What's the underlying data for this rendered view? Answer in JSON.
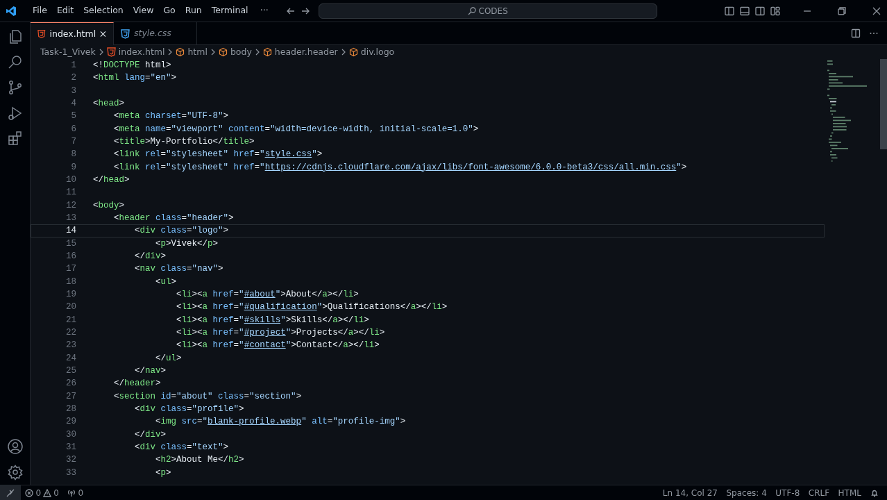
{
  "title_bar": {
    "menus": [
      "File",
      "Edit",
      "Selection",
      "View",
      "Go",
      "Run",
      "Terminal"
    ],
    "more": "···",
    "search": "CODES"
  },
  "tabs": [
    {
      "label": "index.html",
      "kind": "html",
      "selected": true,
      "preview": false
    },
    {
      "label": "style.css",
      "kind": "css",
      "selected": false,
      "preview": true
    }
  ],
  "breadcrumbs": [
    {
      "label": "Task-1_Vivek",
      "kind": "folder"
    },
    {
      "label": "index.html",
      "kind": "html"
    },
    {
      "label": "html",
      "kind": "element"
    },
    {
      "label": "body",
      "kind": "element"
    },
    {
      "label": "header.header",
      "kind": "element"
    },
    {
      "label": "div.logo",
      "kind": "element"
    }
  ],
  "editor": {
    "lines": [
      {
        "number": "1",
        "selected": false,
        "tokens": [
          {
            "kind": "punct",
            "text": "<!"
          },
          {
            "kind": "tag",
            "text": "DOCTYPE"
          },
          {
            "kind": "text",
            "text": " html"
          },
          {
            "kind": "punct",
            "text": ">"
          }
        ]
      },
      {
        "number": "2",
        "selected": false,
        "tokens": [
          {
            "kind": "punct",
            "text": "<"
          },
          {
            "kind": "tag",
            "text": "html"
          },
          {
            "kind": "attr",
            "text": " lang"
          },
          {
            "kind": "punct",
            "text": "="
          },
          {
            "kind": "string",
            "text": "\"en\""
          },
          {
            "kind": "punct",
            "text": ">"
          }
        ]
      },
      {
        "number": "3",
        "selected": false
      },
      {
        "number": "4",
        "selected": false,
        "tokens": [
          {
            "kind": "punct",
            "text": "<"
          },
          {
            "kind": "tag",
            "text": "head"
          },
          {
            "kind": "punct",
            "text": ">"
          }
        ]
      },
      {
        "number": "5",
        "selected": false,
        "tokens": [
          {
            "kind": "punct",
            "text": "    <"
          },
          {
            "kind": "tag",
            "text": "meta"
          },
          {
            "kind": "attr",
            "text": " charset"
          },
          {
            "kind": "punct",
            "text": "="
          },
          {
            "kind": "string",
            "text": "\"UTF-8\""
          },
          {
            "kind": "punct",
            "text": ">"
          }
        ]
      },
      {
        "number": "6",
        "selected": false,
        "tokens": [
          {
            "kind": "punct",
            "text": "    <"
          },
          {
            "kind": "tag",
            "text": "meta"
          },
          {
            "kind": "attr",
            "text": " name"
          },
          {
            "kind": "punct",
            "text": "="
          },
          {
            "kind": "string",
            "text": "\"viewport\""
          },
          {
            "kind": "attr",
            "text": " content"
          },
          {
            "kind": "punct",
            "text": "="
          },
          {
            "kind": "string",
            "text": "\"width=device-width, initial-scale=1.0\""
          },
          {
            "kind": "punct",
            "text": ">"
          }
        ]
      },
      {
        "number": "7",
        "selected": false,
        "tokens": [
          {
            "kind": "punct",
            "text": "    <"
          },
          {
            "kind": "tag",
            "text": "title"
          },
          {
            "kind": "punct",
            "text": ">"
          },
          {
            "kind": "text",
            "text": "My-Portfolio"
          },
          {
            "kind": "punct",
            "text": "</"
          },
          {
            "kind": "tag",
            "text": "title"
          },
          {
            "kind": "punct",
            "text": ">"
          }
        ]
      },
      {
        "number": "8",
        "selected": false,
        "tokens": [
          {
            "kind": "punct",
            "text": "    <"
          },
          {
            "kind": "tag",
            "text": "link"
          },
          {
            "kind": "attr",
            "text": " rel"
          },
          {
            "kind": "punct",
            "text": "="
          },
          {
            "kind": "string",
            "text": "\"stylesheet\""
          },
          {
            "kind": "attr",
            "text": " href"
          },
          {
            "kind": "punct",
            "text": "="
          },
          {
            "kind": "string",
            "text": "\""
          },
          {
            "kind": "link",
            "text": "style.css"
          },
          {
            "kind": "string",
            "text": "\""
          },
          {
            "kind": "punct",
            "text": ">"
          }
        ]
      },
      {
        "number": "9",
        "selected": false,
        "tokens": [
          {
            "kind": "punct",
            "text": "    <"
          },
          {
            "kind": "tag",
            "text": "link"
          },
          {
            "kind": "attr",
            "text": " rel"
          },
          {
            "kind": "punct",
            "text": "="
          },
          {
            "kind": "string",
            "text": "\"stylesheet\""
          },
          {
            "kind": "attr",
            "text": " href"
          },
          {
            "kind": "punct",
            "text": "="
          },
          {
            "kind": "string",
            "text": "\""
          },
          {
            "kind": "link",
            "text": "https://cdnjs.cloudflare.com/ajax/libs/font-awesome/6.0.0-beta3/css/all.min.css"
          },
          {
            "kind": "string",
            "text": "\""
          },
          {
            "kind": "punct",
            "text": ">"
          }
        ]
      },
      {
        "number": "10",
        "selected": false,
        "tokens": [
          {
            "kind": "punct",
            "text": "</"
          },
          {
            "kind": "tag",
            "text": "head"
          },
          {
            "kind": "punct",
            "text": ">"
          }
        ]
      },
      {
        "number": "11",
        "selected": false
      },
      {
        "number": "12",
        "selected": false,
        "tokens": [
          {
            "kind": "punct",
            "text": "<"
          },
          {
            "kind": "tag",
            "text": "body"
          },
          {
            "kind": "punct",
            "text": ">"
          }
        ]
      },
      {
        "number": "13",
        "selected": false,
        "tokens": [
          {
            "kind": "punct",
            "text": "    <"
          },
          {
            "kind": "tag",
            "text": "header"
          },
          {
            "kind": "attr",
            "text": " class"
          },
          {
            "kind": "punct",
            "text": "="
          },
          {
            "kind": "string",
            "text": "\"header\""
          },
          {
            "kind": "punct",
            "text": ">"
          }
        ]
      },
      {
        "number": "14",
        "selected": true,
        "tokens": [
          {
            "kind": "punct",
            "text": "        <"
          },
          {
            "kind": "tag",
            "text": "div"
          },
          {
            "kind": "attr",
            "text": " class"
          },
          {
            "kind": "punct",
            "text": "="
          },
          {
            "kind": "string",
            "text": "\"logo\""
          },
          {
            "kind": "punct",
            "text": ">"
          }
        ]
      },
      {
        "number": "15",
        "selected": false,
        "tokens": [
          {
            "kind": "punct",
            "text": "            <"
          },
          {
            "kind": "tag",
            "text": "p"
          },
          {
            "kind": "punct",
            "text": ">"
          },
          {
            "kind": "text",
            "text": "Vivek"
          },
          {
            "kind": "punct",
            "text": "</"
          },
          {
            "kind": "tag",
            "text": "p"
          },
          {
            "kind": "punct",
            "text": ">"
          }
        ]
      },
      {
        "number": "16",
        "selected": false,
        "tokens": [
          {
            "kind": "punct",
            "text": "        </"
          },
          {
            "kind": "tag",
            "text": "div"
          },
          {
            "kind": "punct",
            "text": ">"
          }
        ]
      },
      {
        "number": "17",
        "selected": false,
        "tokens": [
          {
            "kind": "punct",
            "text": "        <"
          },
          {
            "kind": "tag",
            "text": "nav"
          },
          {
            "kind": "attr",
            "text": " class"
          },
          {
            "kind": "punct",
            "text": "="
          },
          {
            "kind": "string",
            "text": "\"nav\""
          },
          {
            "kind": "punct",
            "text": ">"
          }
        ]
      },
      {
        "number": "18",
        "selected": false,
        "tokens": [
          {
            "kind": "punct",
            "text": "            <"
          },
          {
            "kind": "tag",
            "text": "ul"
          },
          {
            "kind": "punct",
            "text": ">"
          }
        ]
      },
      {
        "number": "19",
        "selected": false,
        "tokens": [
          {
            "kind": "punct",
            "text": "                <"
          },
          {
            "kind": "tag",
            "text": "li"
          },
          {
            "kind": "punct",
            "text": "><"
          },
          {
            "kind": "tag",
            "text": "a"
          },
          {
            "kind": "attr",
            "text": " href"
          },
          {
            "kind": "punct",
            "text": "="
          },
          {
            "kind": "string",
            "text": "\""
          },
          {
            "kind": "link",
            "text": "#about"
          },
          {
            "kind": "string",
            "text": "\""
          },
          {
            "kind": "punct",
            "text": ">"
          },
          {
            "kind": "text",
            "text": "About"
          },
          {
            "kind": "punct",
            "text": "</"
          },
          {
            "kind": "tag",
            "text": "a"
          },
          {
            "kind": "punct",
            "text": "></"
          },
          {
            "kind": "tag",
            "text": "li"
          },
          {
            "kind": "punct",
            "text": ">"
          }
        ]
      },
      {
        "number": "20",
        "selected": false,
        "tokens": [
          {
            "kind": "punct",
            "text": "                <"
          },
          {
            "kind": "tag",
            "text": "li"
          },
          {
            "kind": "punct",
            "text": "><"
          },
          {
            "kind": "tag",
            "text": "a"
          },
          {
            "kind": "attr",
            "text": " href"
          },
          {
            "kind": "punct",
            "text": "="
          },
          {
            "kind": "string",
            "text": "\""
          },
          {
            "kind": "link",
            "text": "#qualification"
          },
          {
            "kind": "string",
            "text": "\""
          },
          {
            "kind": "punct",
            "text": ">"
          },
          {
            "kind": "text",
            "text": "Qualifications"
          },
          {
            "kind": "punct",
            "text": "</"
          },
          {
            "kind": "tag",
            "text": "a"
          },
          {
            "kind": "punct",
            "text": "></"
          },
          {
            "kind": "tag",
            "text": "li"
          },
          {
            "kind": "punct",
            "text": ">"
          }
        ]
      },
      {
        "number": "21",
        "selected": false,
        "tokens": [
          {
            "kind": "punct",
            "text": "                <"
          },
          {
            "kind": "tag",
            "text": "li"
          },
          {
            "kind": "punct",
            "text": "><"
          },
          {
            "kind": "tag",
            "text": "a"
          },
          {
            "kind": "attr",
            "text": " href"
          },
          {
            "kind": "punct",
            "text": "="
          },
          {
            "kind": "string",
            "text": "\""
          },
          {
            "kind": "link",
            "text": "#skills"
          },
          {
            "kind": "string",
            "text": "\""
          },
          {
            "kind": "punct",
            "text": ">"
          },
          {
            "kind": "text",
            "text": "Skills"
          },
          {
            "kind": "punct",
            "text": "</"
          },
          {
            "kind": "tag",
            "text": "a"
          },
          {
            "kind": "punct",
            "text": "></"
          },
          {
            "kind": "tag",
            "text": "li"
          },
          {
            "kind": "punct",
            "text": ">"
          }
        ]
      },
      {
        "number": "22",
        "selected": false,
        "tokens": [
          {
            "kind": "punct",
            "text": "                <"
          },
          {
            "kind": "tag",
            "text": "li"
          },
          {
            "kind": "punct",
            "text": "><"
          },
          {
            "kind": "tag",
            "text": "a"
          },
          {
            "kind": "attr",
            "text": " href"
          },
          {
            "kind": "punct",
            "text": "="
          },
          {
            "kind": "string",
            "text": "\""
          },
          {
            "kind": "link",
            "text": "#project"
          },
          {
            "kind": "string",
            "text": "\""
          },
          {
            "kind": "punct",
            "text": ">"
          },
          {
            "kind": "text",
            "text": "Projects"
          },
          {
            "kind": "punct",
            "text": "</"
          },
          {
            "kind": "tag",
            "text": "a"
          },
          {
            "kind": "punct",
            "text": "></"
          },
          {
            "kind": "tag",
            "text": "li"
          },
          {
            "kind": "punct",
            "text": ">"
          }
        ]
      },
      {
        "number": "23",
        "selected": false,
        "tokens": [
          {
            "kind": "punct",
            "text": "                <"
          },
          {
            "kind": "tag",
            "text": "li"
          },
          {
            "kind": "punct",
            "text": "><"
          },
          {
            "kind": "tag",
            "text": "a"
          },
          {
            "kind": "attr",
            "text": " href"
          },
          {
            "kind": "punct",
            "text": "="
          },
          {
            "kind": "string",
            "text": "\""
          },
          {
            "kind": "link",
            "text": "#contact"
          },
          {
            "kind": "string",
            "text": "\""
          },
          {
            "kind": "punct",
            "text": ">"
          },
          {
            "kind": "text",
            "text": "Contact"
          },
          {
            "kind": "punct",
            "text": "</"
          },
          {
            "kind": "tag",
            "text": "a"
          },
          {
            "kind": "punct",
            "text": "></"
          },
          {
            "kind": "tag",
            "text": "li"
          },
          {
            "kind": "punct",
            "text": ">"
          }
        ]
      },
      {
        "number": "24",
        "selected": false,
        "tokens": [
          {
            "kind": "punct",
            "text": "            </"
          },
          {
            "kind": "tag",
            "text": "ul"
          },
          {
            "kind": "punct",
            "text": ">"
          }
        ]
      },
      {
        "number": "25",
        "selected": false,
        "tokens": [
          {
            "kind": "punct",
            "text": "        </"
          },
          {
            "kind": "tag",
            "text": "nav"
          },
          {
            "kind": "punct",
            "text": ">"
          }
        ]
      },
      {
        "number": "26",
        "selected": false,
        "tokens": [
          {
            "kind": "punct",
            "text": "    </"
          },
          {
            "kind": "tag",
            "text": "header"
          },
          {
            "kind": "punct",
            "text": ">"
          }
        ]
      },
      {
        "number": "27",
        "selected": false,
        "tokens": [
          {
            "kind": "punct",
            "text": "    <"
          },
          {
            "kind": "tag",
            "text": "section"
          },
          {
            "kind": "attr",
            "text": " id"
          },
          {
            "kind": "punct",
            "text": "="
          },
          {
            "kind": "string",
            "text": "\"about\""
          },
          {
            "kind": "attr",
            "text": " class"
          },
          {
            "kind": "punct",
            "text": "="
          },
          {
            "kind": "string",
            "text": "\"section\""
          },
          {
            "kind": "punct",
            "text": ">"
          }
        ]
      },
      {
        "number": "28",
        "selected": false,
        "tokens": [
          {
            "kind": "punct",
            "text": "        <"
          },
          {
            "kind": "tag",
            "text": "div"
          },
          {
            "kind": "attr",
            "text": " class"
          },
          {
            "kind": "punct",
            "text": "="
          },
          {
            "kind": "string",
            "text": "\"profile\""
          },
          {
            "kind": "punct",
            "text": ">"
          }
        ]
      },
      {
        "number": "29",
        "selected": false,
        "tokens": [
          {
            "kind": "punct",
            "text": "            <"
          },
          {
            "kind": "tag",
            "text": "img"
          },
          {
            "kind": "attr",
            "text": " src"
          },
          {
            "kind": "punct",
            "text": "="
          },
          {
            "kind": "string",
            "text": "\""
          },
          {
            "kind": "link",
            "text": "blank-profile.webp"
          },
          {
            "kind": "string",
            "text": "\""
          },
          {
            "kind": "attr",
            "text": " alt"
          },
          {
            "kind": "punct",
            "text": "="
          },
          {
            "kind": "string",
            "text": "\"profile-img\""
          },
          {
            "kind": "punct",
            "text": ">"
          }
        ]
      },
      {
        "number": "30",
        "selected": false,
        "tokens": [
          {
            "kind": "punct",
            "text": "        </"
          },
          {
            "kind": "tag",
            "text": "div"
          },
          {
            "kind": "punct",
            "text": ">"
          }
        ]
      },
      {
        "number": "31",
        "selected": false,
        "tokens": [
          {
            "kind": "punct",
            "text": "        <"
          },
          {
            "kind": "tag",
            "text": "div"
          },
          {
            "kind": "attr",
            "text": " class"
          },
          {
            "kind": "punct",
            "text": "="
          },
          {
            "kind": "string",
            "text": "\"text\""
          },
          {
            "kind": "punct",
            "text": ">"
          }
        ]
      },
      {
        "number": "32",
        "selected": false,
        "tokens": [
          {
            "kind": "punct",
            "text": "            <"
          },
          {
            "kind": "tag",
            "text": "h2"
          },
          {
            "kind": "punct",
            "text": ">"
          },
          {
            "kind": "text",
            "text": "About Me"
          },
          {
            "kind": "punct",
            "text": "</"
          },
          {
            "kind": "tag",
            "text": "h2"
          },
          {
            "kind": "punct",
            "text": ">"
          }
        ]
      },
      {
        "number": "33",
        "selected": false,
        "tokens": [
          {
            "kind": "punct",
            "text": "            <"
          },
          {
            "kind": "tag",
            "text": "p"
          },
          {
            "kind": "punct",
            "text": ">"
          }
        ]
      }
    ]
  },
  "status_bar": {
    "errors": "0",
    "warnings": "0",
    "ports": "0",
    "items": [
      "Ln 14, Col 27",
      "Spaces: 4",
      "UTF-8",
      "CRLF",
      "HTML"
    ]
  }
}
